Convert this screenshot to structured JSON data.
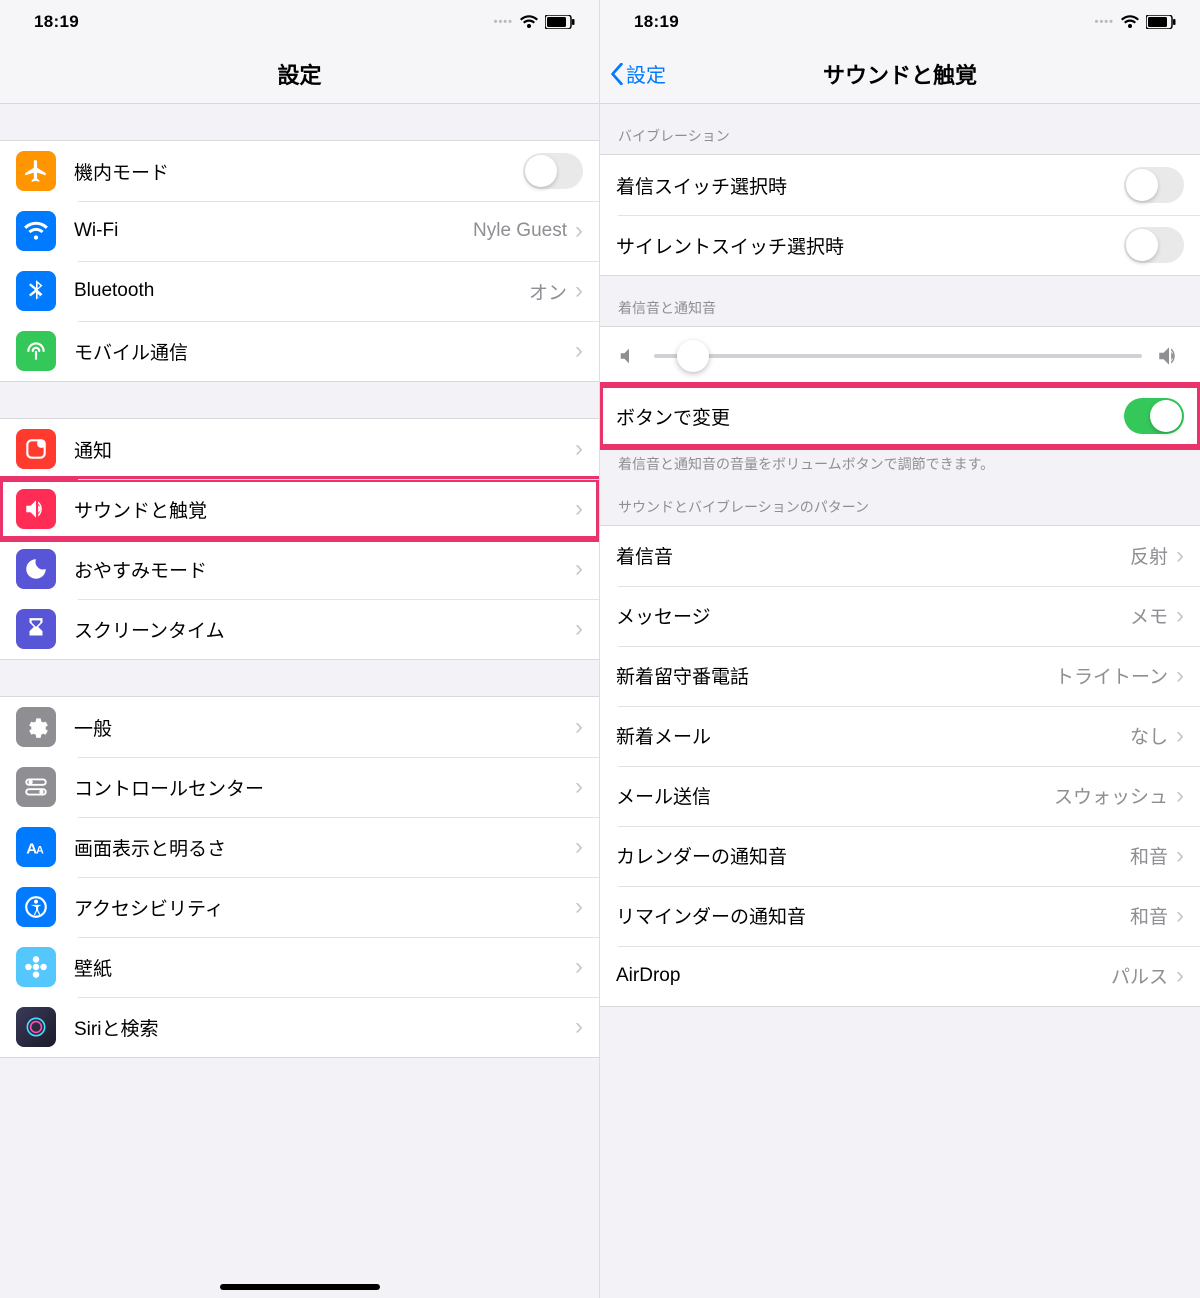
{
  "status": {
    "time": "18:19"
  },
  "left": {
    "title": "設定",
    "items1": [
      {
        "label": "機内モード",
        "color": "#ff9500"
      },
      {
        "label": "Wi-Fi",
        "value": "Nyle Guest",
        "color": "#007aff"
      },
      {
        "label": "Bluetooth",
        "value": "オン",
        "color": "#007aff"
      },
      {
        "label": "モバイル通信",
        "color": "#34c759"
      }
    ],
    "items2": [
      {
        "label": "通知",
        "color": "#ff3b30"
      },
      {
        "label": "サウンドと触覚",
        "color": "#ff2d55"
      },
      {
        "label": "おやすみモード",
        "color": "#5856d6"
      },
      {
        "label": "スクリーンタイム",
        "color": "#5856d6"
      }
    ],
    "items3": [
      {
        "label": "一般",
        "color": "#8e8e93"
      },
      {
        "label": "コントロールセンター",
        "color": "#8e8e93"
      },
      {
        "label": "画面表示と明るさ",
        "color": "#007aff"
      },
      {
        "label": "アクセシビリティ",
        "color": "#007aff"
      },
      {
        "label": "壁紙",
        "color": "#54c7fc"
      },
      {
        "label": "Siriと検索",
        "color": "#1b1b2a"
      }
    ]
  },
  "right": {
    "back": "設定",
    "title": "サウンドと触覚",
    "h_vibration": "バイブレーション",
    "vib1": "着信スイッチ選択時",
    "vib2": "サイレントスイッチ選択時",
    "h_ringer": "着信音と通知音",
    "button_change": "ボタンで変更",
    "footer": "着信音と通知音の音量をボリュームボタンで調節できます。",
    "h_pattern": "サウンドとバイブレーションのパターン",
    "patterns": [
      {
        "label": "着信音",
        "value": "反射"
      },
      {
        "label": "メッセージ",
        "value": "メモ"
      },
      {
        "label": "新着留守番電話",
        "value": "トライトーン"
      },
      {
        "label": "新着メール",
        "value": "なし"
      },
      {
        "label": "メール送信",
        "value": "スウォッシュ"
      },
      {
        "label": "カレンダーの通知音",
        "value": "和音"
      },
      {
        "label": "リマインダーの通知音",
        "value": "和音"
      },
      {
        "label": "AirDrop",
        "value": "パルス"
      }
    ]
  }
}
